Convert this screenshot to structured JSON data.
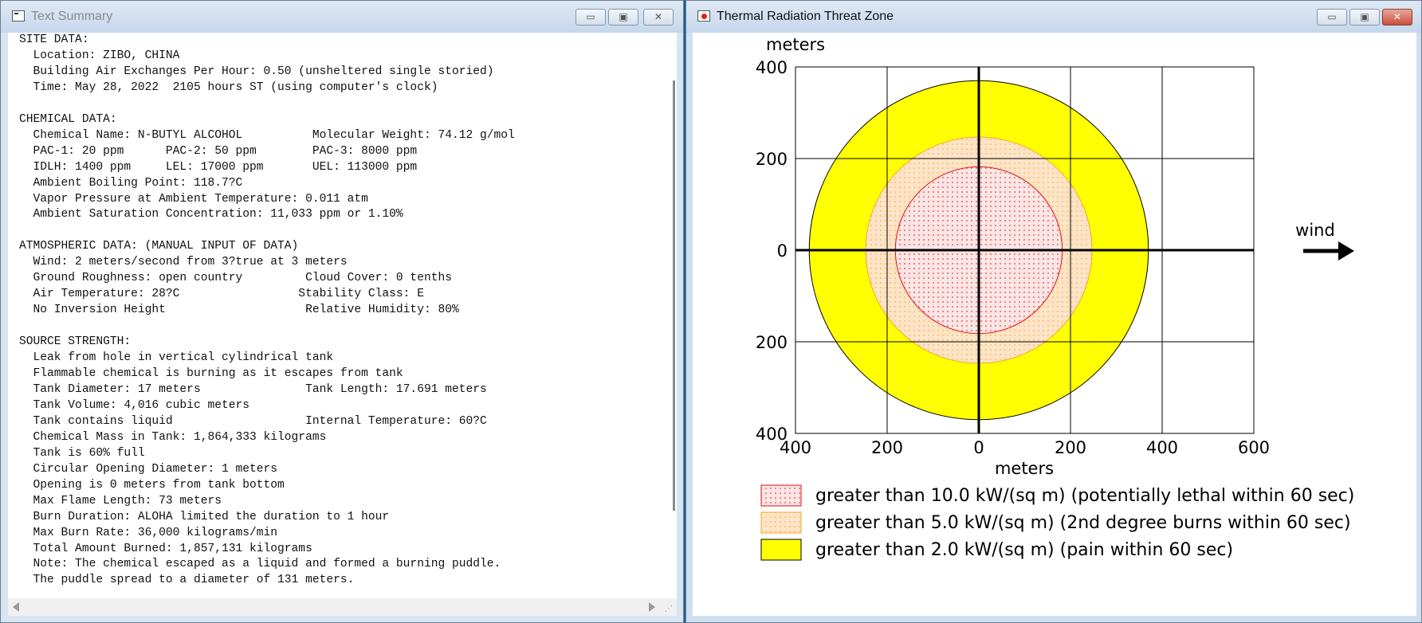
{
  "left_window": {
    "title": "Text Summary",
    "buttons": {
      "minimize": "▭",
      "maximize": "▣",
      "close": "✕"
    },
    "summary_lines": [
      "SITE DATA:",
      "  Location: ZIBO, CHINA",
      "  Building Air Exchanges Per Hour: 0.50 (unsheltered single storied)",
      "  Time: May 28, 2022  2105 hours ST (using computer's clock)",
      "",
      "CHEMICAL DATA:",
      "  Chemical Name: N-BUTYL ALCOHOL          Molecular Weight: 74.12 g/mol",
      "  PAC-1: 20 ppm      PAC-2: 50 ppm        PAC-3: 8000 ppm",
      "  IDLH: 1400 ppm     LEL: 17000 ppm       UEL: 113000 ppm",
      "  Ambient Boiling Point: 118.7?C",
      "  Vapor Pressure at Ambient Temperature: 0.011 atm",
      "  Ambient Saturation Concentration: 11,033 ppm or 1.10%",
      "",
      "ATMOSPHERIC DATA: (MANUAL INPUT OF DATA)",
      "  Wind: 2 meters/second from 3?true at 3 meters",
      "  Ground Roughness: open country         Cloud Cover: 0 tenths",
      "  Air Temperature: 28?C                 Stability Class: E",
      "  No Inversion Height                    Relative Humidity: 80%",
      "",
      "SOURCE STRENGTH:",
      "  Leak from hole in vertical cylindrical tank",
      "  Flammable chemical is burning as it escapes from tank",
      "  Tank Diameter: 17 meters               Tank Length: 17.691 meters",
      "  Tank Volume: 4,016 cubic meters",
      "  Tank contains liquid                   Internal Temperature: 60?C",
      "  Chemical Mass in Tank: 1,864,333 kilograms",
      "  Tank is 60% full",
      "  Circular Opening Diameter: 1 meters",
      "  Opening is 0 meters from tank bottom",
      "  Max Flame Length: 73 meters",
      "  Burn Duration: ALOHA limited the duration to 1 hour",
      "  Max Burn Rate: 36,000 kilograms/min",
      "  Total Amount Burned: 1,857,131 kilograms",
      "  Note: The chemical escaped as a liquid and formed a burning puddle.",
      "  The puddle spread to a diameter of 131 meters."
    ]
  },
  "right_window": {
    "title": "Thermal Radiation Threat Zone",
    "buttons": {
      "minimize": "▭",
      "maximize": "▣",
      "close": "✕"
    }
  },
  "chart_data": {
    "type": "threat_zone",
    "ylabel": "meters",
    "xlabel": "meters",
    "x_ticks": [
      "400",
      "200",
      "0",
      "200",
      "400",
      "600"
    ],
    "y_ticks": [
      "400",
      "200",
      "0",
      "200",
      "400"
    ],
    "xlim": [
      -400,
      600
    ],
    "ylim": [
      -400,
      400
    ],
    "grid": true,
    "wind_label": "wind",
    "zones": [
      {
        "radius_m": 370,
        "color": "#ffff00",
        "pattern": "solid",
        "legend": "greater than 2.0 kW/(sq m) (pain within 60 sec)"
      },
      {
        "radius_m": 247,
        "color": "#f5a623",
        "pattern": "dots",
        "legend": "greater than 5.0 kW/(sq m) (2nd degree burns within 60 sec)"
      },
      {
        "radius_m": 182,
        "color": "#e01010",
        "pattern": "dots",
        "legend": "greater than 10.0 kW/(sq m) (potentially lethal within 60 sec)"
      }
    ]
  }
}
